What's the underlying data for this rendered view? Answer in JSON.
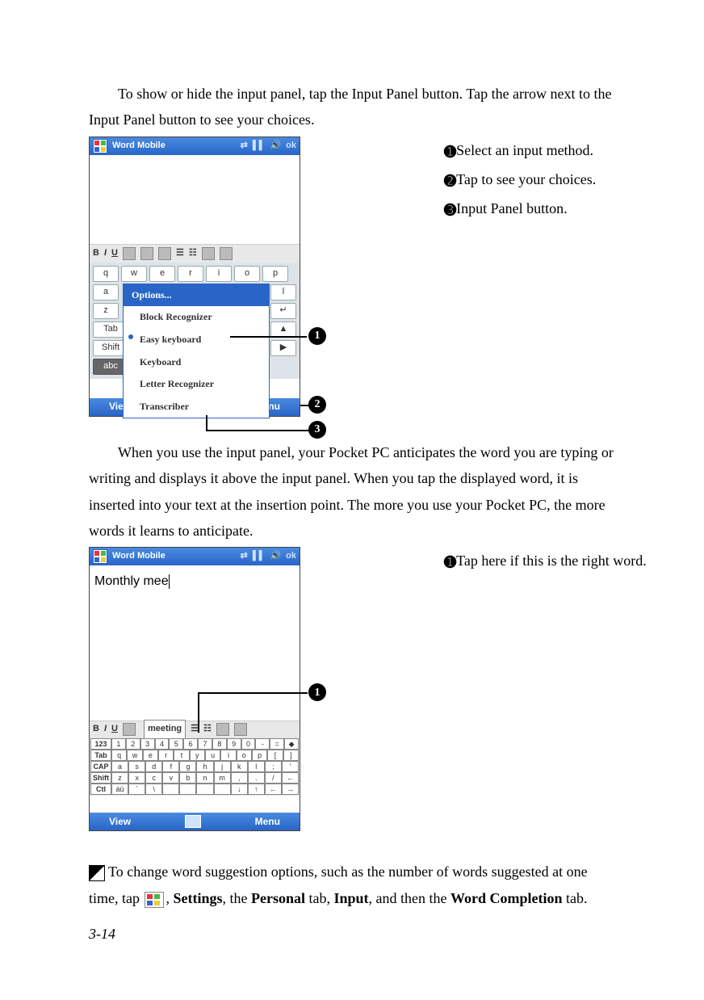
{
  "para1": "To show or hide the input panel, tap the Input Panel button. Tap the arrow next to the Input Panel button to see your choices.",
  "callouts1": {
    "n1": "➊",
    "t1": "Select an input method.",
    "n2": "➋",
    "t2": "Tap to see your choices.",
    "n3": "➌",
    "t3": "Input Panel button."
  },
  "shot1": {
    "title": "Word Mobile",
    "title_ok": "ok",
    "toolbar": [
      "B",
      "I",
      "U"
    ],
    "keyb_row1": [
      "q",
      "w",
      "e",
      "r",
      "i",
      "o",
      "p"
    ],
    "keyb_row2_left": "a",
    "keyb_row2_right": "l",
    "keyb_row3_left": "z",
    "keyb_row4_left": "Tab",
    "keyb_row5_left": "Shift",
    "keyb_row6_left": "abc",
    "menu_header": "Options...",
    "menu_items": [
      "Block Recognizer",
      "Easy keyboard",
      "Keyboard",
      "Letter Recognizer",
      "Transcriber"
    ],
    "menu_selected_index": 1,
    "bottom_left": "View",
    "bottom_right": "Menu"
  },
  "para2": "When you use the input panel, your Pocket PC anticipates the word you are typing or writing and displays it above the input panel. When you tap the displayed word, it is inserted into your text at the insertion point. The more you use your Pocket PC, the more words it learns to anticipate.",
  "callouts2": {
    "n1": "➊",
    "t1": "Tap here if this is the right word."
  },
  "shot2": {
    "title": "Word Mobile",
    "title_ok": "ok",
    "typed_text": "Monthly mee",
    "suggestion": "meeting",
    "toolbar": [
      "B",
      "I",
      "U"
    ],
    "kb_rows": [
      {
        "lbl": "123",
        "cells": [
          "1",
          "2",
          "3",
          "4",
          "5",
          "6",
          "7",
          "8",
          "9",
          "0",
          "-",
          "=",
          "◆"
        ]
      },
      {
        "lbl": "Tab",
        "cells": [
          "q",
          "w",
          "e",
          "r",
          "t",
          "y",
          "u",
          "i",
          "o",
          "p",
          "[",
          "]"
        ]
      },
      {
        "lbl": "CAP",
        "cells": [
          "a",
          "s",
          "d",
          "f",
          "g",
          "h",
          "j",
          "k",
          "l",
          ";",
          "'"
        ]
      },
      {
        "lbl": "Shift",
        "cells": [
          "z",
          "x",
          "c",
          "v",
          "b",
          "n",
          "m",
          ",",
          ".",
          "/",
          "←"
        ]
      },
      {
        "lbl": "Ctl",
        "cells": [
          "áü",
          "`",
          "\\",
          " ",
          " ",
          " ",
          " ",
          "↓",
          "↑",
          "←",
          "→"
        ]
      }
    ],
    "bottom_left": "View",
    "bottom_right": "Menu"
  },
  "tip": {
    "pre": "To change word suggestion options, such as the number of words suggested at one time, tap ",
    "settings": "Settings",
    "sep1": ", the ",
    "personal": "Personal",
    "tab_word": " tab, ",
    "input": "Input",
    "sep2": ", and then the ",
    "wc": "Word Completion",
    "post": " tab."
  },
  "page_num": "3-14"
}
